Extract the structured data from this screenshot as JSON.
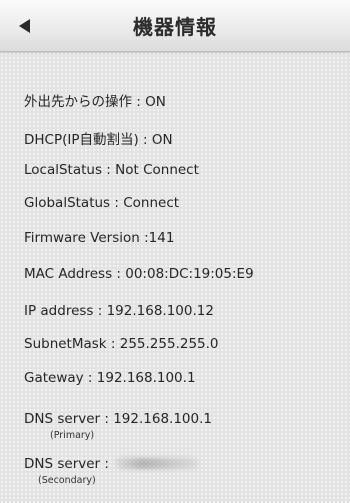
{
  "header": {
    "title": "機器情報"
  },
  "info": {
    "remote_operation": "外出先からの操作 : ON",
    "dhcp": "DHCP(IP自動割当) : ON",
    "local_status": "LocalStatus : Not Connect",
    "global_status": "GlobalStatus : Connect",
    "firmware": "Firmware Version :141",
    "mac": "MAC Address : 00:08:DC:19:05:E9",
    "ip": "IP address : 192.168.100.12",
    "subnet": "SubnetMask : 255.255.255.0",
    "gateway": "Gateway : 192.168.100.1",
    "dns_primary": "DNS server : 192.168.100.1",
    "dns_primary_note": "(Primary)",
    "dns_secondary_label": "DNS server :",
    "dns_secondary_note": "(Secondary)"
  },
  "icons": {
    "back": "back-arrow-icon"
  }
}
